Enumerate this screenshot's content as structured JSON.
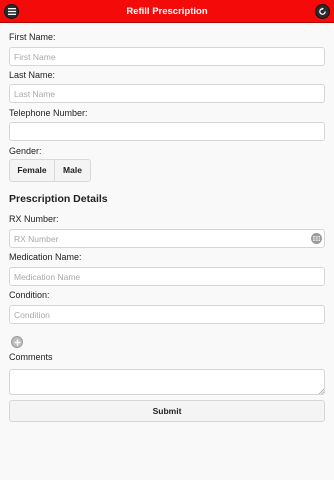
{
  "header": {
    "title": "Refill Prescription",
    "menu_icon": "hamburger-menu-icon",
    "refresh_icon": "refresh-icon",
    "background_color": "#f50a0a"
  },
  "form": {
    "first_name": {
      "label": "First Name:",
      "placeholder": "First Name",
      "value": ""
    },
    "last_name": {
      "label": "Last Name:",
      "placeholder": "Last Name",
      "value": ""
    },
    "telephone": {
      "label": "Telephone Number:",
      "placeholder": "",
      "value": ""
    },
    "gender": {
      "label": "Gender:",
      "options": [
        "Female",
        "Male"
      ]
    }
  },
  "prescription": {
    "title": "Prescription Details",
    "rx_number": {
      "label": "RX Number:",
      "placeholder": "RX Number",
      "value": "",
      "icon": "barcode-scan-icon"
    },
    "medication_name": {
      "label": "Medication Name:",
      "placeholder": "Medication Name",
      "value": ""
    },
    "condition": {
      "label": "Condition:",
      "placeholder": "Condition",
      "value": ""
    },
    "add_icon": "add-circle-icon"
  },
  "comments": {
    "label": "Comments",
    "value": ""
  },
  "submit": {
    "label": "Submit"
  }
}
